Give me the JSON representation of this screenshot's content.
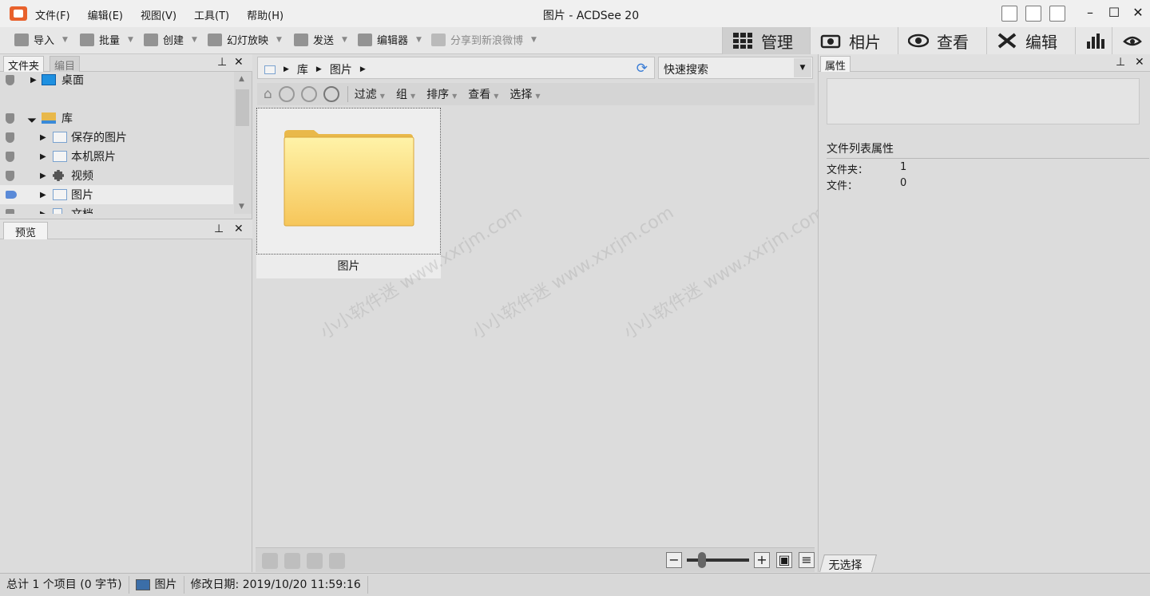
{
  "window": {
    "title": "图片 - ACDSee 20",
    "menu": [
      "文件(F)",
      "编辑(E)",
      "视图(V)",
      "工具(T)",
      "帮助(H)"
    ]
  },
  "toolbar": {
    "import": "导入",
    "batch": "批量",
    "create": "创建",
    "slideshow": "幻灯放映",
    "send": "发送",
    "editor": "编辑器",
    "share_weibo": "分享到新浪微博"
  },
  "modes": {
    "manage": "管理",
    "photos": "相片",
    "view": "查看",
    "edit": "编辑"
  },
  "left": {
    "tab_folders": "文件夹",
    "tab_catalog": "编目",
    "tree": [
      {
        "label": "桌面"
      },
      {
        "label": "库"
      },
      {
        "label": "保存的图片"
      },
      {
        "label": "本机照片"
      },
      {
        "label": "视频"
      },
      {
        "label": "图片"
      },
      {
        "label": "文档"
      }
    ],
    "preview_tab": "预览"
  },
  "center": {
    "breadcrumb": [
      "库",
      "图片"
    ],
    "quick_search": "快速搜索",
    "filters": [
      "过滤",
      "组",
      "排序",
      "查看",
      "选择"
    ],
    "items": [
      {
        "label": "图片"
      }
    ]
  },
  "right": {
    "tab": "属性",
    "section_title": "文件列表属性",
    "folders_label": "文件夹：",
    "folders_value": "1",
    "files_label": "文件：",
    "files_value": "0",
    "no_selection": "无选择"
  },
  "status": {
    "total": "总计 1 个项目 (0 字节)",
    "current": "图片",
    "modified": "修改日期: 2019/10/20 11:59:16"
  },
  "watermark": "小小软件迷 www.xxrjm.com"
}
